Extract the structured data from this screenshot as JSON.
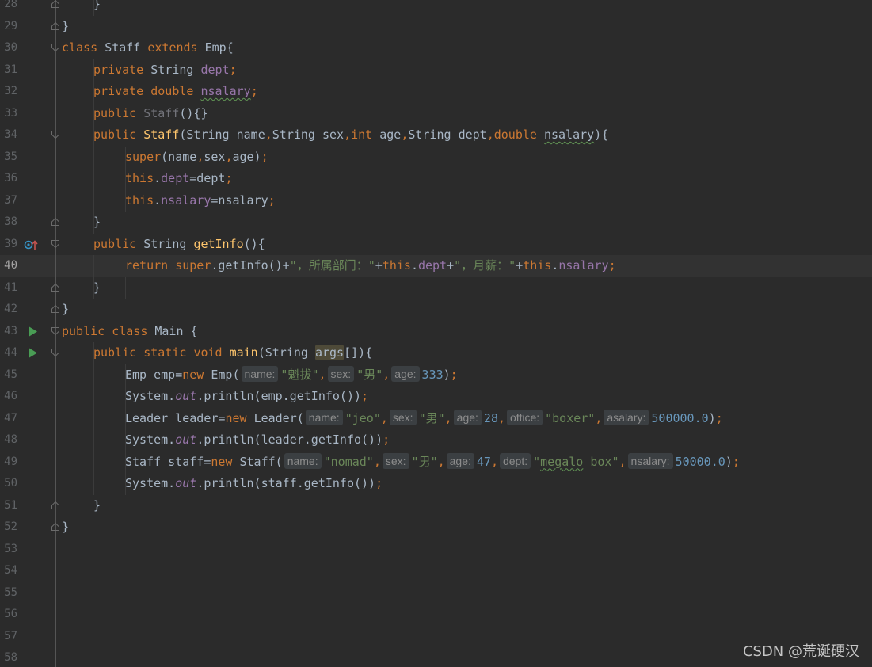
{
  "editor": {
    "current_line": 40,
    "lines": [
      {
        "n": "28",
        "fold": "end",
        "indent": 1,
        "tokens": [
          {
            "t": "}",
            "c": "plain"
          }
        ]
      },
      {
        "n": "29",
        "fold": "end",
        "indent": 0,
        "tokens": [
          {
            "t": "}",
            "c": "plain"
          }
        ]
      },
      {
        "n": "30",
        "fold": "start",
        "indent": 0,
        "tokens": [
          {
            "t": "class ",
            "c": "kw"
          },
          {
            "t": "Staff ",
            "c": "plain"
          },
          {
            "t": "extends ",
            "c": "kw"
          },
          {
            "t": "Emp{",
            "c": "plain"
          }
        ]
      },
      {
        "n": "31",
        "indent": 1,
        "tokens": [
          {
            "t": "private ",
            "c": "kw"
          },
          {
            "t": "String ",
            "c": "plain"
          },
          {
            "t": "dept",
            "c": "fld"
          },
          {
            "t": ";",
            "c": "pun"
          }
        ]
      },
      {
        "n": "32",
        "indent": 1,
        "tokens": [
          {
            "t": "private ",
            "c": "kw"
          },
          {
            "t": "double ",
            "c": "kw"
          },
          {
            "t": "nsalary",
            "c": "fld squiggle"
          },
          {
            "t": ";",
            "c": "pun"
          }
        ]
      },
      {
        "n": "33",
        "indent": 1,
        "tokens": [
          {
            "t": "public ",
            "c": "kw"
          },
          {
            "t": "Staff",
            "c": "unused"
          },
          {
            "t": "(){}",
            "c": "plain"
          }
        ]
      },
      {
        "n": "34",
        "fold": "start",
        "indent": 1,
        "tokens": [
          {
            "t": "public ",
            "c": "kw"
          },
          {
            "t": "Staff",
            "c": "fn"
          },
          {
            "t": "(String name",
            "c": "plain"
          },
          {
            "t": ",",
            "c": "pun"
          },
          {
            "t": "String sex",
            "c": "plain"
          },
          {
            "t": ",",
            "c": "pun"
          },
          {
            "t": "int ",
            "c": "kw"
          },
          {
            "t": "age",
            "c": "plain"
          },
          {
            "t": ",",
            "c": "pun"
          },
          {
            "t": "String dept",
            "c": "plain"
          },
          {
            "t": ",",
            "c": "pun"
          },
          {
            "t": "double ",
            "c": "kw"
          },
          {
            "t": "nsalary",
            "c": "plain squiggle"
          },
          {
            "t": "){",
            "c": "plain"
          }
        ]
      },
      {
        "n": "35",
        "indent": 2,
        "tokens": [
          {
            "t": "super",
            "c": "kw"
          },
          {
            "t": "(name",
            "c": "plain"
          },
          {
            "t": ",",
            "c": "pun"
          },
          {
            "t": "sex",
            "c": "plain"
          },
          {
            "t": ",",
            "c": "pun"
          },
          {
            "t": "age)",
            "c": "plain"
          },
          {
            "t": ";",
            "c": "pun"
          }
        ]
      },
      {
        "n": "36",
        "indent": 2,
        "tokens": [
          {
            "t": "this",
            "c": "kw"
          },
          {
            "t": ".",
            "c": "plain"
          },
          {
            "t": "dept",
            "c": "fld"
          },
          {
            "t": "=dept",
            "c": "plain"
          },
          {
            "t": ";",
            "c": "pun"
          }
        ]
      },
      {
        "n": "37",
        "indent": 2,
        "tokens": [
          {
            "t": "this",
            "c": "kw"
          },
          {
            "t": ".",
            "c": "plain"
          },
          {
            "t": "nsalary",
            "c": "fld"
          },
          {
            "t": "=nsalary",
            "c": "plain"
          },
          {
            "t": ";",
            "c": "pun"
          }
        ]
      },
      {
        "n": "38",
        "fold": "end",
        "indent": 1,
        "tokens": [
          {
            "t": "}",
            "c": "plain"
          }
        ]
      },
      {
        "n": "39",
        "fold": "start",
        "icon": "override",
        "indent": 1,
        "tokens": [
          {
            "t": "public ",
            "c": "kw"
          },
          {
            "t": "String ",
            "c": "plain"
          },
          {
            "t": "getInfo",
            "c": "fn"
          },
          {
            "t": "(){",
            "c": "plain"
          }
        ]
      },
      {
        "n": "40",
        "indent": 2,
        "tokens": [
          {
            "t": "return ",
            "c": "kw"
          },
          {
            "t": "super",
            "c": "kw"
          },
          {
            "t": ".getInfo()+",
            "c": "plain"
          },
          {
            "t": "\"，所属部门：\"",
            "c": "str"
          },
          {
            "t": "+",
            "c": "plain"
          },
          {
            "t": "this",
            "c": "kw"
          },
          {
            "t": ".",
            "c": "plain"
          },
          {
            "t": "dept",
            "c": "fld"
          },
          {
            "t": "+",
            "c": "plain"
          },
          {
            "t": "\"，月薪：\"",
            "c": "str"
          },
          {
            "t": "+",
            "c": "plain"
          },
          {
            "t": "this",
            "c": "kw"
          },
          {
            "t": ".",
            "c": "plain"
          },
          {
            "t": "nsalary",
            "c": "fld"
          },
          {
            "t": ";",
            "c": "pun"
          }
        ]
      },
      {
        "n": "41",
        "fold": "end",
        "indent": 1,
        "tokens": [
          {
            "t": "}",
            "c": "plain"
          }
        ]
      },
      {
        "n": "42",
        "fold": "end",
        "indent": 0,
        "tokens": [
          {
            "t": "}",
            "c": "plain"
          }
        ]
      },
      {
        "n": "43",
        "fold": "start",
        "icon": "run",
        "indent": 0,
        "tokens": [
          {
            "t": "public ",
            "c": "kw"
          },
          {
            "t": "class ",
            "c": "kw"
          },
          {
            "t": "Main {",
            "c": "plain"
          }
        ]
      },
      {
        "n": "44",
        "fold": "start",
        "icon": "run",
        "indent": 1,
        "tokens": [
          {
            "t": "public ",
            "c": "kw"
          },
          {
            "t": "static ",
            "c": "kw"
          },
          {
            "t": "void ",
            "c": "kw"
          },
          {
            "t": "main",
            "c": "fn"
          },
          {
            "t": "(String ",
            "c": "plain"
          },
          {
            "t": "args",
            "c": "plain hl-args"
          },
          {
            "t": "[]){",
            "c": "plain"
          }
        ]
      },
      {
        "n": "45",
        "indent": 2,
        "tokens": [
          {
            "t": "Emp emp=",
            "c": "plain"
          },
          {
            "t": "new ",
            "c": "kw"
          },
          {
            "t": "Emp(",
            "c": "plain"
          },
          {
            "hint": "name:"
          },
          {
            "t": "\"魁拔\"",
            "c": "str"
          },
          {
            "t": ",",
            "c": "pun"
          },
          {
            "hint": "sex:"
          },
          {
            "t": "\"男\"",
            "c": "str"
          },
          {
            "t": ",",
            "c": "pun"
          },
          {
            "hint": "age:"
          },
          {
            "t": "333",
            "c": "num"
          },
          {
            "t": ")",
            "c": "plain"
          },
          {
            "t": ";",
            "c": "pun"
          }
        ]
      },
      {
        "n": "46",
        "indent": 2,
        "tokens": [
          {
            "t": "System.",
            "c": "plain"
          },
          {
            "t": "out",
            "c": "static-m"
          },
          {
            "t": ".println(emp.getInfo())",
            "c": "plain"
          },
          {
            "t": ";",
            "c": "pun"
          }
        ]
      },
      {
        "n": "47",
        "indent": 2,
        "tokens": [
          {
            "t": "Leader leader=",
            "c": "plain"
          },
          {
            "t": "new ",
            "c": "kw"
          },
          {
            "t": "Leader(",
            "c": "plain"
          },
          {
            "hint": "name:"
          },
          {
            "t": "\"jeo\"",
            "c": "str"
          },
          {
            "t": ",",
            "c": "pun"
          },
          {
            "hint": "sex:"
          },
          {
            "t": "\"男\"",
            "c": "str"
          },
          {
            "t": ",",
            "c": "pun"
          },
          {
            "hint": "age:"
          },
          {
            "t": "28",
            "c": "num"
          },
          {
            "t": ",",
            "c": "pun"
          },
          {
            "hint": "office:"
          },
          {
            "t": "\"boxer\"",
            "c": "str"
          },
          {
            "t": ",",
            "c": "pun"
          },
          {
            "hint": "asalary:"
          },
          {
            "t": "500000.0",
            "c": "num"
          },
          {
            "t": ")",
            "c": "plain"
          },
          {
            "t": ";",
            "c": "pun"
          }
        ]
      },
      {
        "n": "48",
        "indent": 2,
        "tokens": [
          {
            "t": "System.",
            "c": "plain"
          },
          {
            "t": "out",
            "c": "static-m"
          },
          {
            "t": ".println(leader.getInfo())",
            "c": "plain"
          },
          {
            "t": ";",
            "c": "pun"
          }
        ]
      },
      {
        "n": "49",
        "indent": 2,
        "tokens": [
          {
            "t": "Staff staff=",
            "c": "plain"
          },
          {
            "t": "new ",
            "c": "kw"
          },
          {
            "t": "Staff(",
            "c": "plain"
          },
          {
            "hint": "name:"
          },
          {
            "t": "\"nomad\"",
            "c": "str"
          },
          {
            "t": ",",
            "c": "pun"
          },
          {
            "hint": "sex:"
          },
          {
            "t": "\"男\"",
            "c": "str"
          },
          {
            "t": ",",
            "c": "pun"
          },
          {
            "hint": "age:"
          },
          {
            "t": "47",
            "c": "num"
          },
          {
            "t": ",",
            "c": "pun"
          },
          {
            "hint": "dept:"
          },
          {
            "t": "\"",
            "c": "str"
          },
          {
            "t": "megalo",
            "c": "str squiggle"
          },
          {
            "t": " box\"",
            "c": "str"
          },
          {
            "t": ",",
            "c": "pun"
          },
          {
            "hint": "nsalary:"
          },
          {
            "t": "50000.0",
            "c": "num"
          },
          {
            "t": ")",
            "c": "plain"
          },
          {
            "t": ";",
            "c": "pun"
          }
        ]
      },
      {
        "n": "50",
        "indent": 2,
        "tokens": [
          {
            "t": "System.",
            "c": "plain"
          },
          {
            "t": "out",
            "c": "static-m"
          },
          {
            "t": ".println(staff.getInfo())",
            "c": "plain"
          },
          {
            "t": ";",
            "c": "pun"
          }
        ]
      },
      {
        "n": "51",
        "fold": "end",
        "indent": 1,
        "tokens": [
          {
            "t": "}",
            "c": "plain"
          }
        ]
      },
      {
        "n": "52",
        "fold": "end",
        "indent": 0,
        "tokens": [
          {
            "t": "}",
            "c": "plain"
          }
        ]
      },
      {
        "n": "53",
        "indent": 0,
        "tokens": []
      },
      {
        "n": "54",
        "indent": 0,
        "tokens": []
      },
      {
        "n": "55",
        "indent": 0,
        "tokens": []
      },
      {
        "n": "56",
        "indent": 0,
        "tokens": []
      },
      {
        "n": "57",
        "indent": 0,
        "tokens": []
      },
      {
        "n": "58",
        "indent": 0,
        "tokens": []
      }
    ]
  },
  "watermark": "CSDN @荒诞硬汉",
  "colors": {
    "background": "#2b2b2b",
    "caret_row": "#323232",
    "keyword": "#cc7832",
    "function": "#ffc66d",
    "field": "#9876aa",
    "string": "#6a8759",
    "number": "#6897bb",
    "text": "#a9b7c6"
  }
}
